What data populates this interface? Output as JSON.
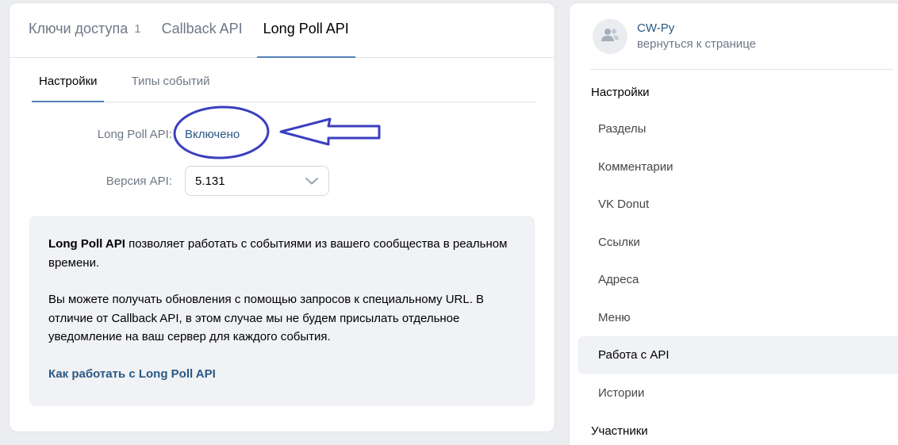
{
  "top_tabs": [
    {
      "label": "Ключи доступа",
      "counter": "1"
    },
    {
      "label": "Callback API"
    },
    {
      "label": "Long Poll API",
      "active": true
    }
  ],
  "sub_tabs": [
    {
      "label": "Настройки",
      "active": true
    },
    {
      "label": "Типы событий"
    }
  ],
  "settings": {
    "longpoll_label": "Long Poll API:",
    "longpoll_value": "Включено",
    "version_label": "Версия API:",
    "version_value": "5.131"
  },
  "info": {
    "p1_bold": "Long Poll API",
    "p1_rest": " позволяет работать с событиями из вашего сообщества в реальном времени.",
    "p2": "Вы можете получать обновления с помощью запросов к специальному URL. В отличие от Callback API, в этом случае мы не будем присылать отдельное уведомление на ваш сервер для каждого события.",
    "link": "Как работать с Long Poll API"
  },
  "group": {
    "name": "CW-Py",
    "back": "вернуться к странице"
  },
  "side_menu": {
    "section1": "Настройки",
    "items": [
      "Разделы",
      "Комментарии",
      "VK Donut",
      "Ссылки",
      "Адреса",
      "Меню",
      "Работа с API",
      "Истории"
    ],
    "active_item": "Работа с API",
    "section2": "Участники"
  },
  "icons": {
    "avatar": "users-icon",
    "select": "chevron-down-icon"
  },
  "colors": {
    "accent": "#5181b8",
    "link": "#2a5885",
    "annotation": "#3a3fbf"
  }
}
